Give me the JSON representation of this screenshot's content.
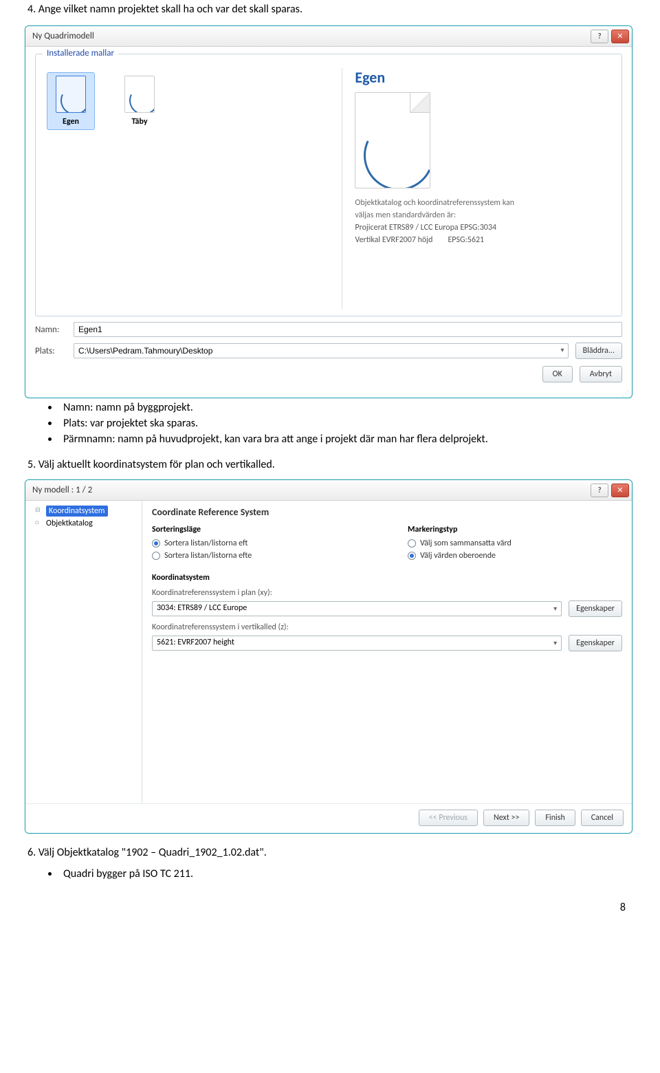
{
  "intro_line": "4.   Ange vilket namn projektet skall ha och var det skall sparas.",
  "dialog1": {
    "title": "Ny Quadrimodell",
    "group_label": "Installerade mallar",
    "templates": [
      {
        "label": "Egen",
        "selected": true
      },
      {
        "label": "Täby",
        "selected": false
      }
    ],
    "preview_title": "Egen",
    "desc1": "Objektkatalog och koordinatreferenssystem kan",
    "desc2": "väljas men standardvärden är:",
    "row1a": "Projicerat ETRS89 / LCC Europa EPSG:3034",
    "row2a": "Vertikal EVRF2007 höjd",
    "row2b": "EPSG:5621",
    "name_label": "Namn:",
    "name_value": "Egen1",
    "path_label": "Plats:",
    "path_value": "C:\\Users\\Pedram.Tahmoury\\Desktop",
    "browse": "Bläddra...",
    "ok": "OK",
    "cancel": "Avbryt"
  },
  "bullets1": [
    "Namn: namn på byggprojekt.",
    "Plats: var projektet ska sparas.",
    "Pärmnamn: namn på huvudprojekt, kan vara bra att ange i projekt där man har flera delprojekt."
  ],
  "step5": "5.   Välj aktuellt koordinatsystem för plan och vertikalled.",
  "dialog2": {
    "title": "Ny modell : 1 / 2",
    "tree_sel": "Koordinatsystem",
    "tree_item2": "Objektkatalog",
    "panel_title": "Coordinate Reference System",
    "sort_label": "Sorteringsläge",
    "sort_opt1": "Sortera listan/listorna eft",
    "sort_opt2": "Sortera listan/listorna efte",
    "mark_label": "Markeringstyp",
    "mark_opt1": "Välj som sammansatta värd",
    "mark_opt2": "Välj värden oberoende",
    "koord_section": "Koordinatsystem",
    "xy_label": "Koordinatreferenssystem i plan (xy):",
    "xy_value": "3034: ETRS89 / LCC Europe",
    "z_label": "Koordinatreferenssystem i vertikalled (z):",
    "z_value": "5621: EVRF2007 height",
    "props": "Egenskaper",
    "prev": "<< Previous",
    "next": "Next >>",
    "finish": "Finish",
    "cancel": "Cancel"
  },
  "step6": "6.   Välj Objektkatalog \"1902 – Quadri_1902_1.02.dat\".",
  "bullets2": [
    "Quadri bygger på ISO TC 211."
  ],
  "page_num": "8"
}
